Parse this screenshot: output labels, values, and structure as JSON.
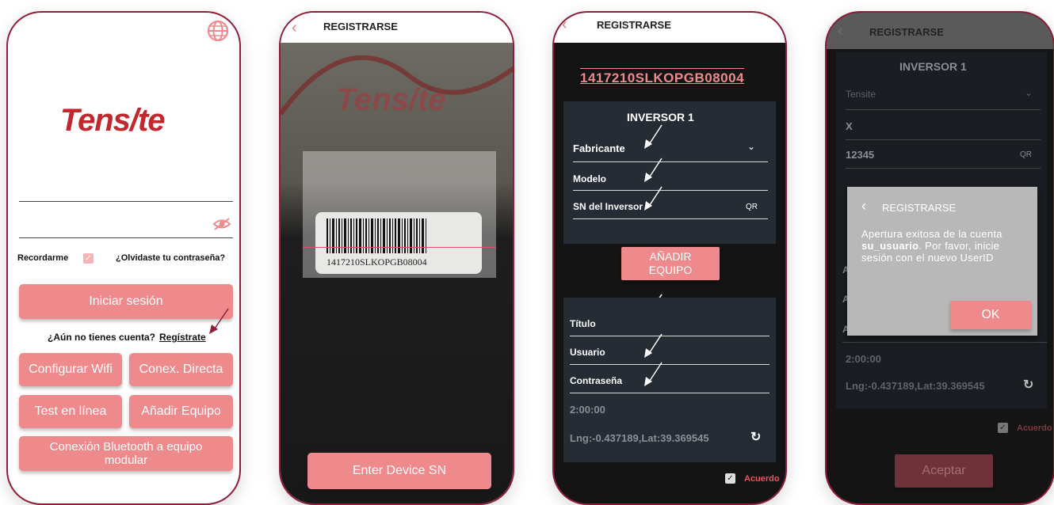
{
  "screen1": {
    "logo": "Tens/te",
    "remember_label": "Recordarme",
    "forgot_link": "¿Olvidaste tu contraseña?",
    "login_button": "Iniciar sesión",
    "no_account_text": "¿Aún no tienes cuenta?",
    "register_link": "Regístrate",
    "buttons": [
      "Configurar Wifi",
      "Conex. Directa",
      "Test en línea",
      "Añadir Equipo"
    ],
    "bluetooth_button": "Conexión Bluetooth a equipo modular"
  },
  "screen2": {
    "header_title": "REGISTRARSE",
    "barcode_text": "1417210SLKOPGB08004",
    "bg_logo": "Tens/te",
    "enter_sn_button": "Enter Device SN"
  },
  "screen3": {
    "header_title": "REGISTRARSE",
    "serial": "1417210SLKOPGB08004",
    "card_title": "INVERSOR 1",
    "fields": {
      "fabricante": "Fabricante",
      "modelo": "Modelo",
      "sn": "SN del Inversor",
      "qr": "QR"
    },
    "add_button": "AÑADIR EQUIPO",
    "titulo": "Título",
    "usuario": "Usuario",
    "contrasena": "Contraseña",
    "time": "2:00:00",
    "location": "Lng:-0.437189,Lat:39.369545",
    "agree": "Acuerdo"
  },
  "screen4": {
    "header_title": "REGISTRARSE",
    "card_title": "INVERSOR 1",
    "manufacturer_value": "Tensite",
    "model_value": "X",
    "sn_value": "12345",
    "qr": "QR",
    "dialog": {
      "title": "REGISTRARSE",
      "msg_pre": "Apertura exitosa de la cuenta ",
      "msg_user": "su_usuario",
      "msg_post": ". Por favor, inicie sesión con el nuevo UserID",
      "ok": "OK"
    },
    "letter_a": "A",
    "time": "2:00:00",
    "location": "Lng:-0.437189,Lat:39.369545",
    "agree": "Acuerdo",
    "accept_button": "Aceptar"
  },
  "colors": {
    "accent": "#ef8a8c",
    "border": "#8e1d37",
    "logo_red": "#c1272d",
    "logo_blue": "#1b3e8f"
  }
}
